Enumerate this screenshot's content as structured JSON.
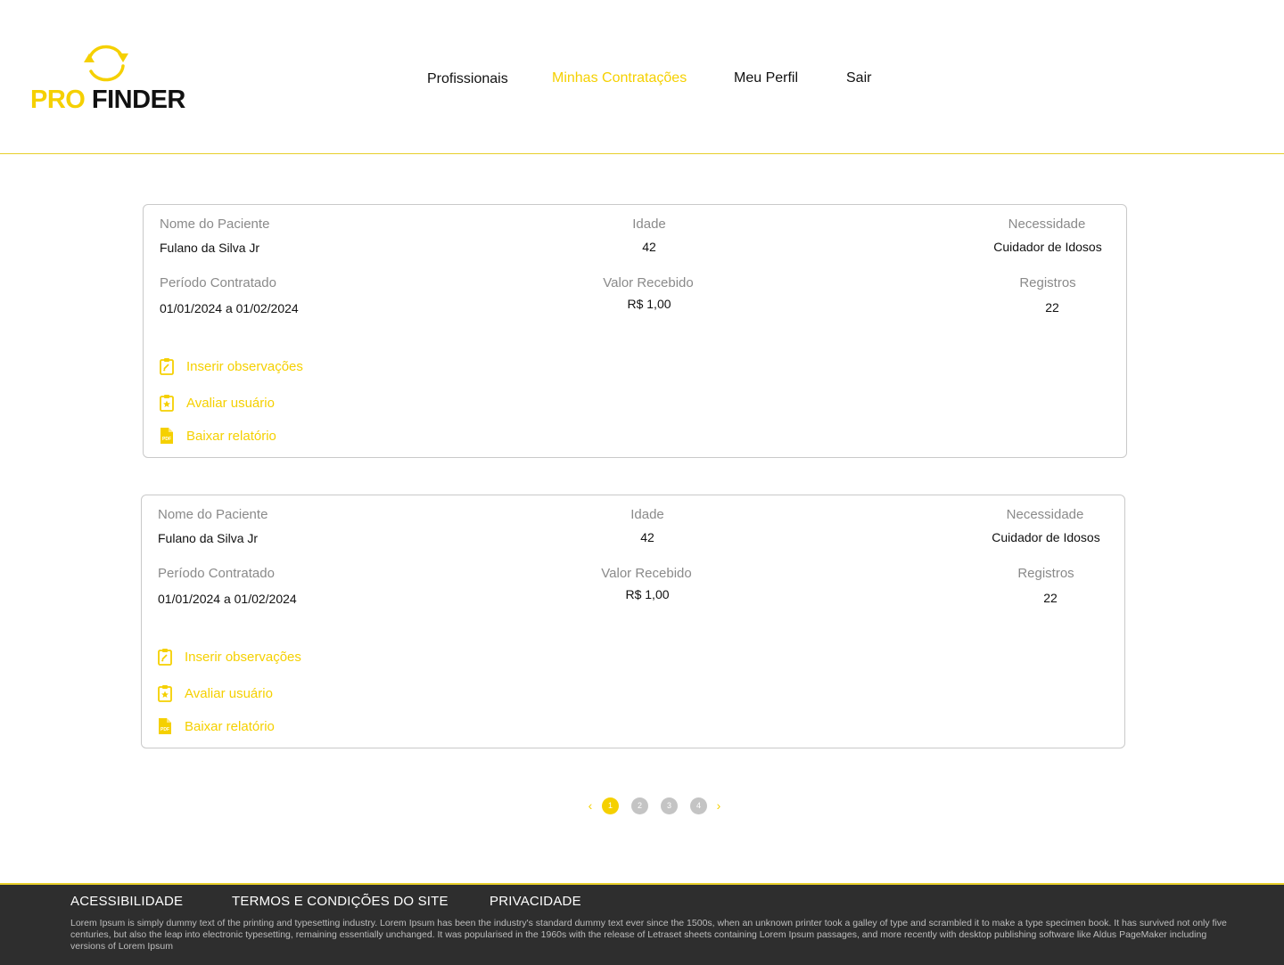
{
  "brand": {
    "part1": "PRO",
    "part2": "FINDER",
    "accent_color": "#f5d000"
  },
  "nav": {
    "profissionais": "Profissionais",
    "contratacoes": "Minhas Contratações",
    "perfil": "Meu Perfil",
    "sair": "Sair"
  },
  "labels": {
    "paciente": "Nome do Paciente",
    "idade": "Idade",
    "necessidade": "Necessidade",
    "periodo": "Período Contratado",
    "valor": "Valor Recebido",
    "registros": "Registros"
  },
  "actions": {
    "observacoes": {
      "label": "Inserir observações",
      "icon": "clipboard-edit-icon"
    },
    "avaliar": {
      "label": "Avaliar usuário",
      "icon": "clipboard-star-icon"
    },
    "baixar": {
      "label": "Baixar relatório",
      "icon": "pdf-file-icon"
    }
  },
  "contracts": [
    {
      "paciente": "Fulano da Silva Jr",
      "idade": "42",
      "necessidade": "Cuidador de Idosos",
      "periodo": "01/01/2024 a 01/02/2024",
      "valor": "R$ 1,00",
      "registros": "22"
    },
    {
      "paciente": "Fulano da Silva Jr",
      "idade": "42",
      "necessidade": "Cuidador de Idosos",
      "periodo": "01/01/2024 a 01/02/2024",
      "valor": "R$ 1,00",
      "registros": "22"
    }
  ],
  "pagination": {
    "prev": "‹",
    "next": "›",
    "pages": [
      "1",
      "2",
      "3",
      "4"
    ],
    "current": "1"
  },
  "footer": {
    "acessibilidade": "ACESSIBILIDADE",
    "termos": "TERMOS E CONDIÇÕES DO SITE",
    "privacidade": "PRIVACIDADE",
    "text": "Lorem Ipsum is simply dummy text of the printing and typesetting industry. Lorem Ipsum has been the industry's standard dummy text ever since the 1500s, when an unknown printer took a galley of type and scrambled it to make a type specimen book. It has survived not only five centuries, but also the leap into electronic typesetting, remaining essentially unchanged. It was popularised in the 1960s with the release of Letraset sheets containing Lorem Ipsum passages, and more recently with desktop publishing software like Aldus PageMaker including versions of Lorem Ipsum"
  }
}
